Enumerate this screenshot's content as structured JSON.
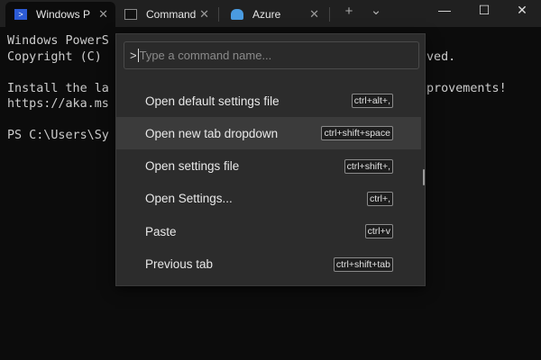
{
  "tabs": [
    {
      "label": "Windows P",
      "icon": "powershell-icon",
      "active": true
    },
    {
      "label": "Command",
      "icon": "cmd-icon",
      "active": false
    },
    {
      "label": "Azure",
      "icon": "azure-cloud-icon",
      "active": false
    }
  ],
  "tab_close": "✕",
  "new_tab": "+",
  "dropdown": "⌄",
  "window": {
    "minimize": "—",
    "maximize": "☐",
    "close": "✕"
  },
  "terminal": {
    "left": [
      "Windows PowerS",
      "Copyright (C)",
      "",
      "Install the la",
      "https://aka.ms",
      "",
      "PS C:\\Users\\Sy"
    ],
    "right": [
      "",
      "ved.",
      "",
      "provements!",
      "",
      "",
      ""
    ]
  },
  "palette": {
    "prefix": ">",
    "placeholder": "Type a command name...",
    "items": [
      {
        "label": "Open default settings file",
        "shortcut": "ctrl+alt+,",
        "selected": false
      },
      {
        "label": "Open new tab dropdown",
        "shortcut": "ctrl+shift+space",
        "selected": true
      },
      {
        "label": "Open settings file",
        "shortcut": "ctrl+shift+,",
        "selected": false
      },
      {
        "label": "Open Settings...",
        "shortcut": "ctrl+,",
        "selected": false
      },
      {
        "label": "Paste",
        "shortcut": "ctrl+v",
        "selected": false
      },
      {
        "label": "Previous tab",
        "shortcut": "ctrl+shift+tab",
        "selected": false
      }
    ]
  },
  "colors": {
    "titlebar": "#202020",
    "terminal_bg": "#0c0c0c",
    "palette_bg": "#2c2c2c",
    "selected_row": "#3b3b3b",
    "powershell": "#2c5bd6",
    "azure": "#4a9be0"
  }
}
